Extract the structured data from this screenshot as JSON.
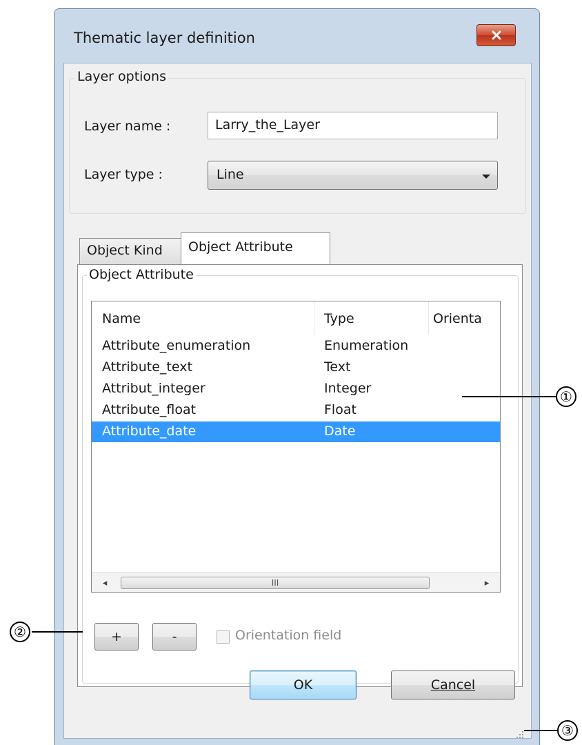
{
  "window": {
    "title": "Thematic layer definition",
    "close_glyph": "✕"
  },
  "layer_options": {
    "group_label": "Layer options",
    "name_label": "Layer name :",
    "name_value": "Larry_the_Layer",
    "type_label": "Layer type :",
    "type_value": "Line"
  },
  "tabs": [
    {
      "label": "Object Kind",
      "active": false
    },
    {
      "label": "Object Attribute",
      "active": true
    }
  ],
  "object_attribute": {
    "group_label": "Object Attribute",
    "columns": [
      "Name",
      "Type",
      "Orienta"
    ],
    "rows": [
      {
        "name": "Attribute_enumeration",
        "type": "Enumeration",
        "selected": false
      },
      {
        "name": "Attribute_text",
        "type": "Text",
        "selected": false
      },
      {
        "name": "Attribut_integer",
        "type": "Integer",
        "selected": false
      },
      {
        "name": "Attribute_float",
        "type": "Float",
        "selected": false
      },
      {
        "name": "Attribute_date",
        "type": "Date",
        "selected": true
      }
    ],
    "scroll_left_glyph": "◂",
    "scroll_right_glyph": "▸",
    "thumb_grip": "III",
    "add_label": "+",
    "remove_label": "-",
    "orientation_label": "Orientation field",
    "orientation_checked": false
  },
  "footer": {
    "ok_label": "OK",
    "cancel_label": "Cancel"
  },
  "callouts": [
    "①",
    "②",
    "③"
  ],
  "colors": {
    "selection": "#3399ff",
    "window_frame": "#c9d9ea",
    "close_button": "#c8452b"
  }
}
